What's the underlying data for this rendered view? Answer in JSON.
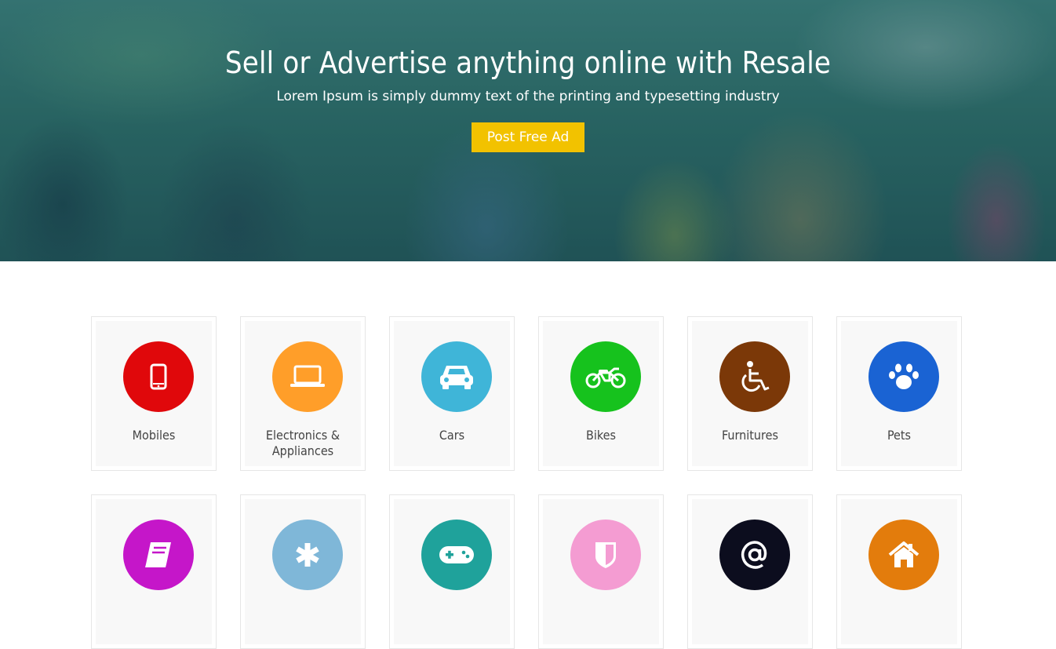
{
  "hero": {
    "title": "Sell or Advertise anything online with Resale",
    "subtitle": "Lorem Ipsum is simply dummy text of the printing and typesetting industry",
    "cta_label": "Post Free Ad"
  },
  "categories": [
    {
      "label": "Mobiles",
      "icon": "mobile-icon",
      "color": "#e0080b"
    },
    {
      "label": "Electronics & Appliances",
      "icon": "laptop-icon",
      "color": "#ff9e29"
    },
    {
      "label": "Cars",
      "icon": "car-icon",
      "color": "#3fb5d8"
    },
    {
      "label": "Bikes",
      "icon": "motorcycle-icon",
      "color": "#16c21d"
    },
    {
      "label": "Furnitures",
      "icon": "wheelchair-icon",
      "color": "#7b3808"
    },
    {
      "label": "Pets",
      "icon": "paw-icon",
      "color": "#1a63d3"
    },
    {
      "label": "",
      "icon": "book-icon",
      "color": "#c516c9"
    },
    {
      "label": "",
      "icon": "asterisk-icon",
      "color": "#7fb7d8"
    },
    {
      "label": "",
      "icon": "gamepad-icon",
      "color": "#1fa29b"
    },
    {
      "label": "",
      "icon": "shield-icon",
      "color": "#f49cd2"
    },
    {
      "label": "",
      "icon": "at-sign-icon",
      "color": "#0c0d1e"
    },
    {
      "label": "",
      "icon": "home-icon",
      "color": "#e37c0c"
    }
  ]
}
